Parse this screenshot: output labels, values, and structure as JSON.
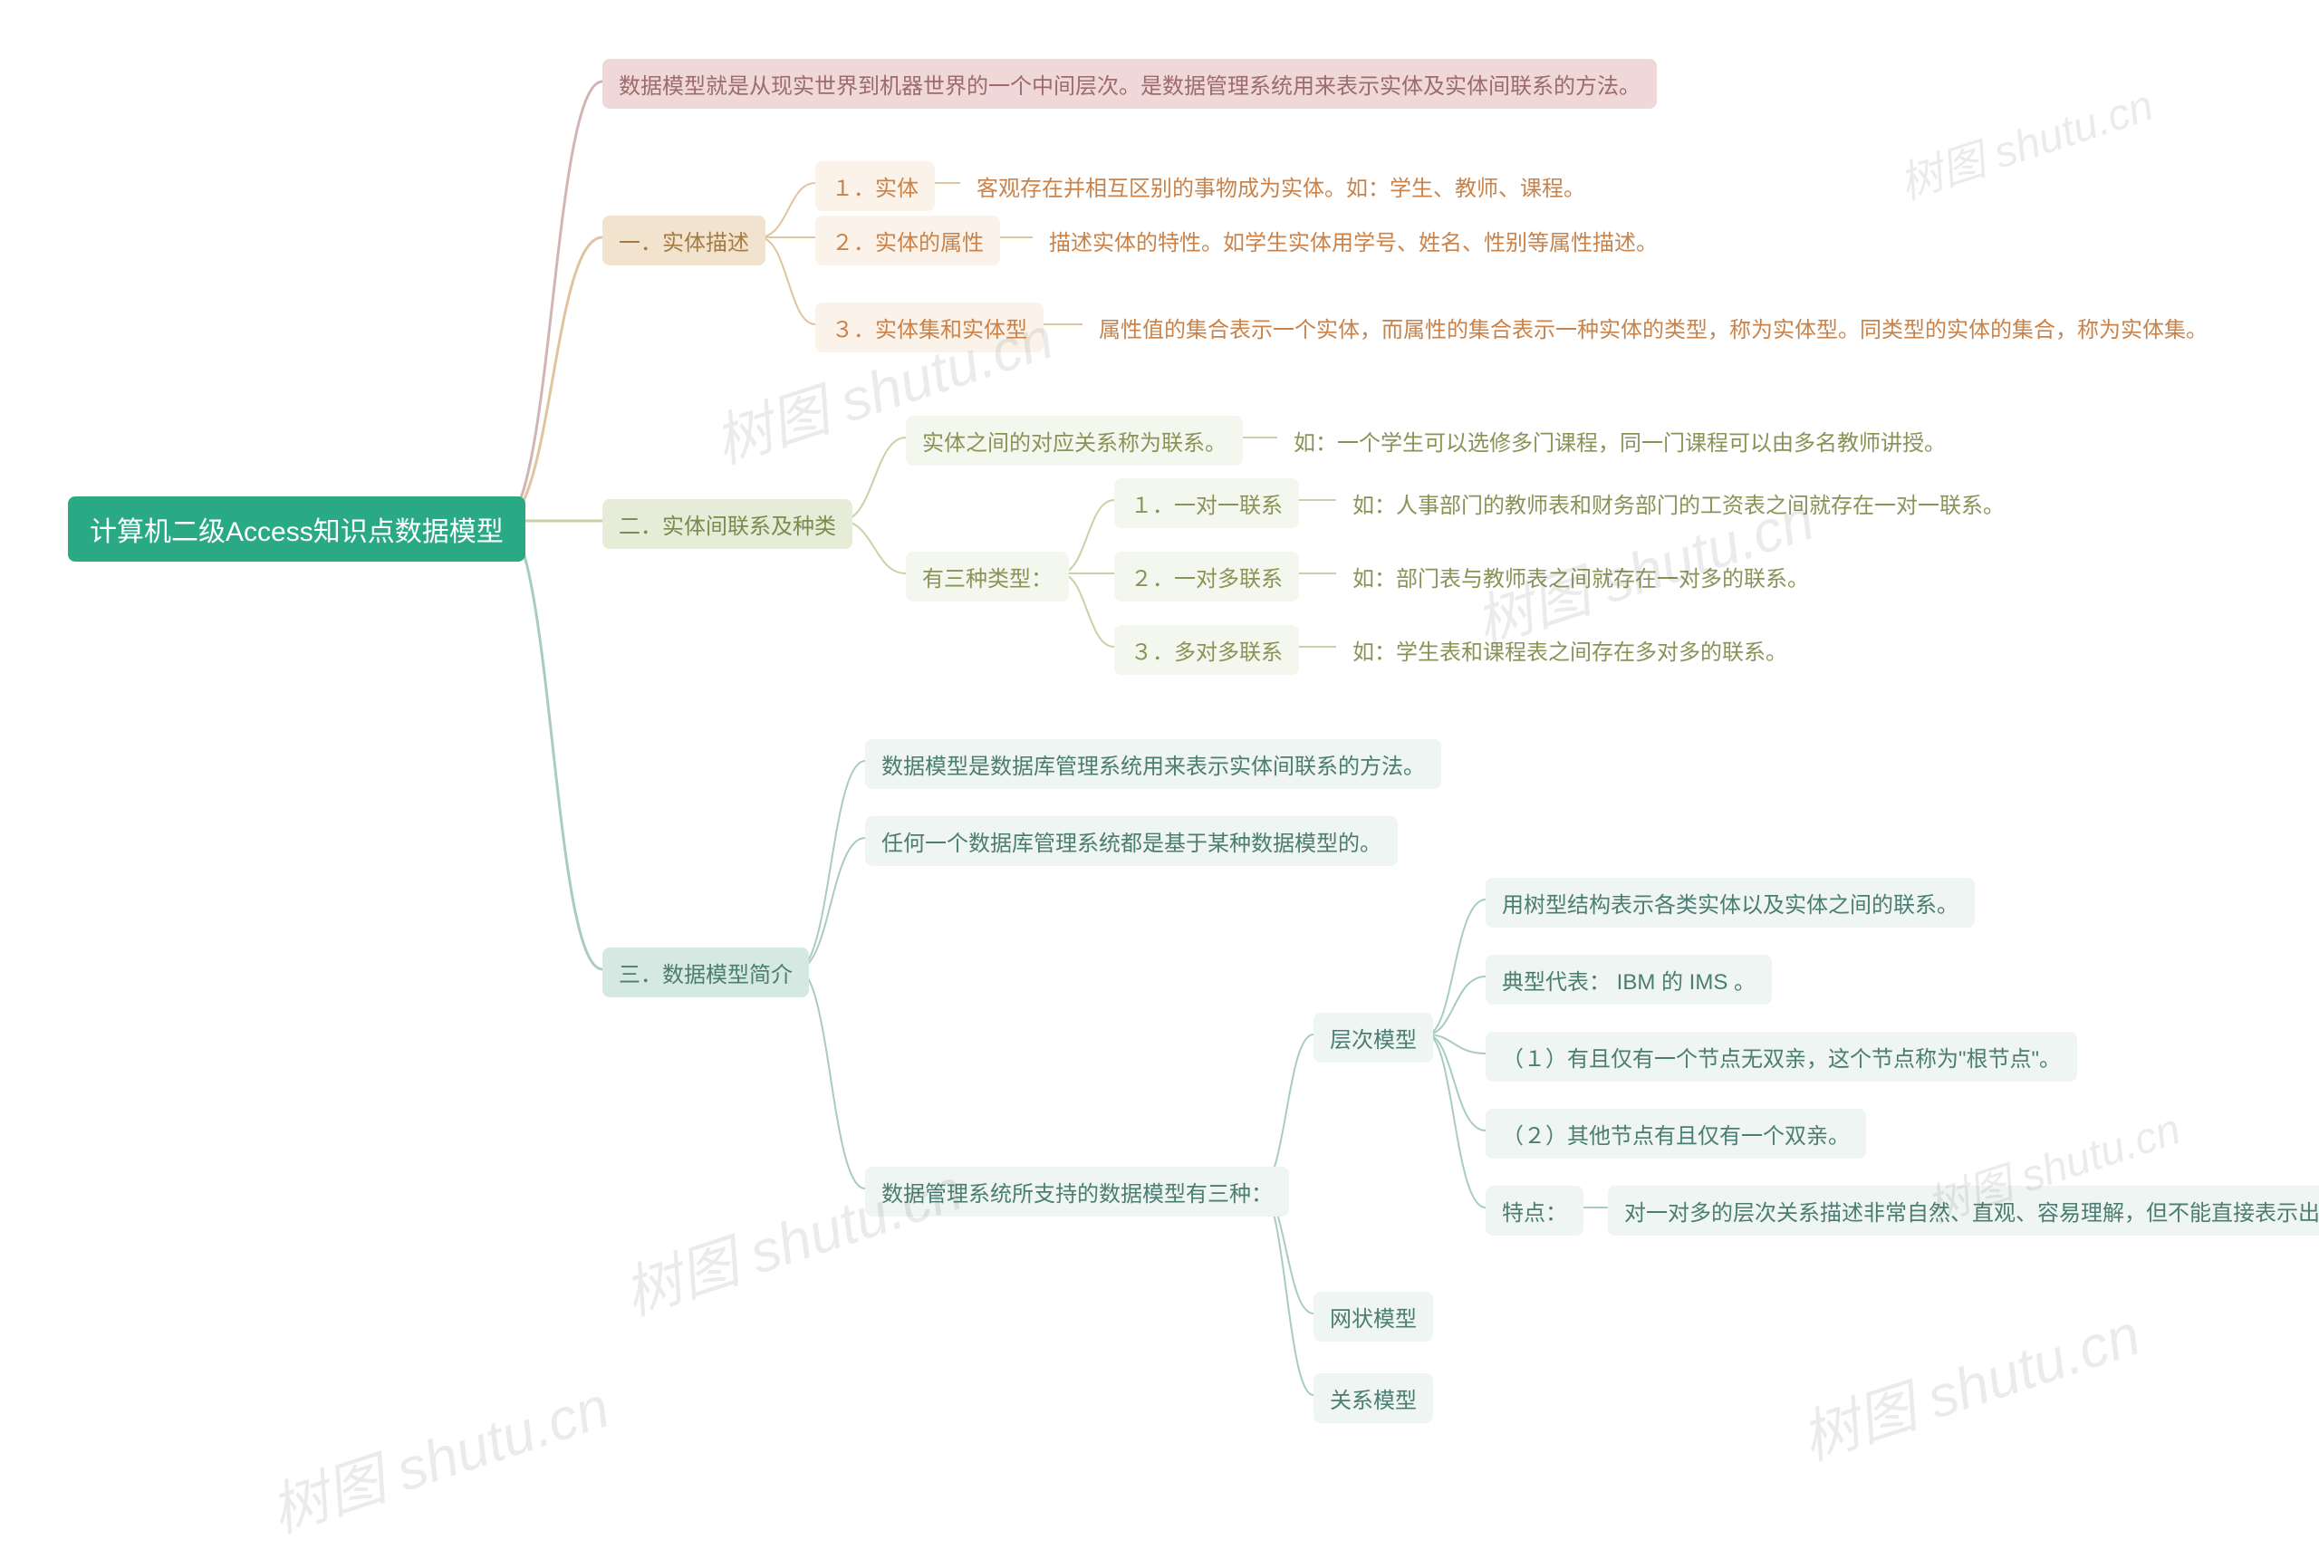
{
  "root": "计算机二级Access知识点数据模型",
  "watermark": "树图 shutu.cn",
  "b0": "数据模型就是从现实世界到机器世界的一个中间层次。是数据管理系统用来表示实体及实体间联系的方法。",
  "b1": {
    "title": "一．实体描述",
    "i1": {
      "label": "１．实体",
      "text": "客观存在并相互区别的事物成为实体。如：学生、教师、课程。"
    },
    "i2": {
      "label": "２．实体的属性",
      "text": "描述实体的特性。如学生实体用学号、姓名、性别等属性描述。"
    },
    "i3": {
      "label": "３．实体集和实体型",
      "text": "属性值的集合表示一个实体，而属性的集合表示一种实体的类型，称为实体型。同类型的实体的集合，称为实体集。"
    }
  },
  "b2": {
    "title": "二．实体间联系及种类",
    "p1": {
      "label": "实体之间的对应关系称为联系。",
      "text": "如：一个学生可以选修多门课程，同一门课程可以由多名教师讲授。"
    },
    "p2": {
      "label": "有三种类型：",
      "t1": {
        "label": "１．一对一联系",
        "text": "如：人事部门的教师表和财务部门的工资表之间就存在一对一联系。"
      },
      "t2": {
        "label": "２．一对多联系",
        "text": "如：部门表与教师表之间就存在一对多的联系。"
      },
      "t3": {
        "label": "３．多对多联系",
        "text": "如：学生表和课程表之间存在多对多的联系。"
      }
    }
  },
  "b3": {
    "title": "三．数据模型简介",
    "s1": "数据模型是数据库管理系统用来表示实体间联系的方法。",
    "s2": "任何一个数据库管理系统都是基于某种数据模型的。",
    "s3": {
      "label": "数据管理系统所支持的数据模型有三种：",
      "m1": {
        "label": "层次模型",
        "d1": "用树型结构表示各类实体以及实体之间的联系。",
        "d2": "典型代表： IBM 的 IMS 。",
        "d3": "（１）有且仅有一个节点无双亲，这个节点称为\"根节点\"。",
        "d4": "（２）其他节点有且仅有一个双亲。",
        "d5": {
          "label": "特点：",
          "text": "对一对多的层次关系描述非常自然、直观、容易理解，但不能直接表示出多对多的联系。"
        }
      },
      "m2": "网状模型",
      "m3": "关系模型"
    }
  }
}
